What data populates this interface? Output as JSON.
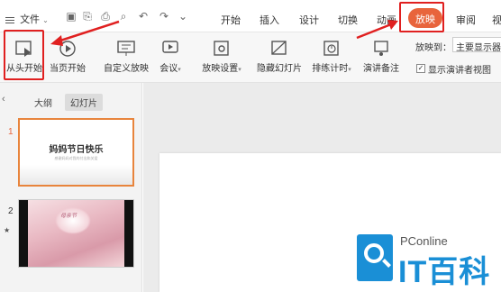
{
  "menubar": {
    "file_label": "文件",
    "tabs": [
      "开始",
      "插入",
      "设计",
      "切换",
      "动画",
      "放映",
      "审阅",
      "视"
    ],
    "active_tab": "放映",
    "accent_color": "#e8643c",
    "highlight_color": "#e02020"
  },
  "ribbon": {
    "buttons": [
      "从头开始",
      "当页开始",
      "自定义放映",
      "会议",
      "放映设置",
      "隐藏幻灯片",
      "排练计时",
      "演讲备注"
    ],
    "playto_label": "放映到：",
    "playto_value": "主要显示器",
    "presenter_view_label": "显示演讲者视图",
    "presenter_view_checked": true
  },
  "panel": {
    "tabs": [
      "大纲",
      "幻灯片"
    ],
    "selected_tab": "幻灯片",
    "slides": [
      {
        "num": "1",
        "title": "妈妈节日快乐",
        "subtitle": "感谢妈妈对我的付出和关爱"
      },
      {
        "num": "2",
        "photo_text": "母亲节"
      }
    ]
  },
  "watermark": {
    "brand": "PConline",
    "name": "IT百科"
  }
}
